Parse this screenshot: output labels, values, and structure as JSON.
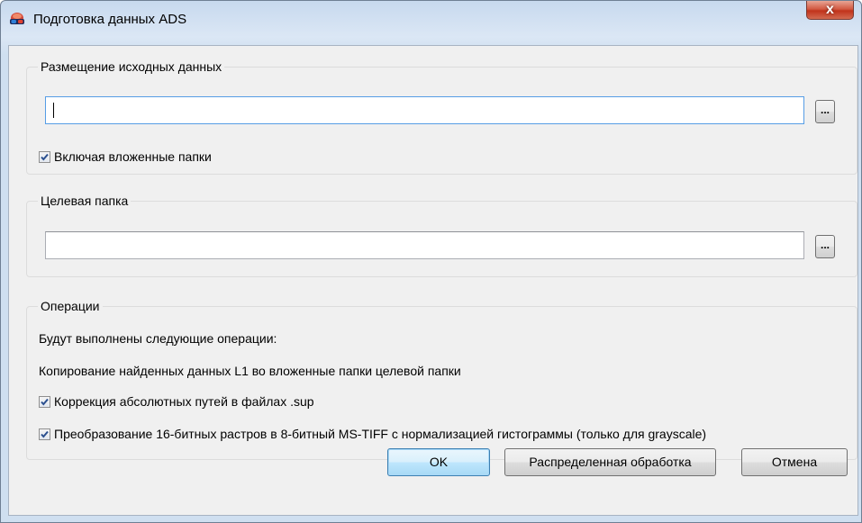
{
  "window": {
    "title": "Подготовка данных ADS",
    "close_label": "x"
  },
  "source_group": {
    "title": "Размещение исходных данных",
    "path_value": "",
    "browse_label": "...",
    "include_subfolders": {
      "label": "Включая вложенные папки",
      "checked": true
    }
  },
  "target_group": {
    "title": "Целевая папка",
    "path_value": "",
    "browse_label": "..."
  },
  "operations_group": {
    "title": "Операции",
    "intro_text": "Будут выполнены следующие операции:",
    "copy_text": "Копирование найденных данных L1 во вложенные папки целевой папки",
    "fix_paths": {
      "label": "Коррекция абсолютных путей в файлах .sup",
      "checked": true
    },
    "convert_rasters": {
      "label": "Преобразование 16-битных растров в 8-битный MS-TIFF с нормализацией гистограммы (только для grayscale)",
      "checked": true
    }
  },
  "buttons": {
    "ok_label": "OK",
    "distributed_label": "Распределенная обработка",
    "cancel_label": "Отмена"
  },
  "colors": {
    "title_bar": "#dbe7f5",
    "client_bg": "#f0f0f0",
    "close_button": "#c1331b",
    "checkmark": "#2a4f8f",
    "default_button_border": "#3c7fb1"
  },
  "icons": {
    "app": "stereo-glasses-icon",
    "close": "close-icon",
    "checkmark": "checkmark-icon"
  }
}
